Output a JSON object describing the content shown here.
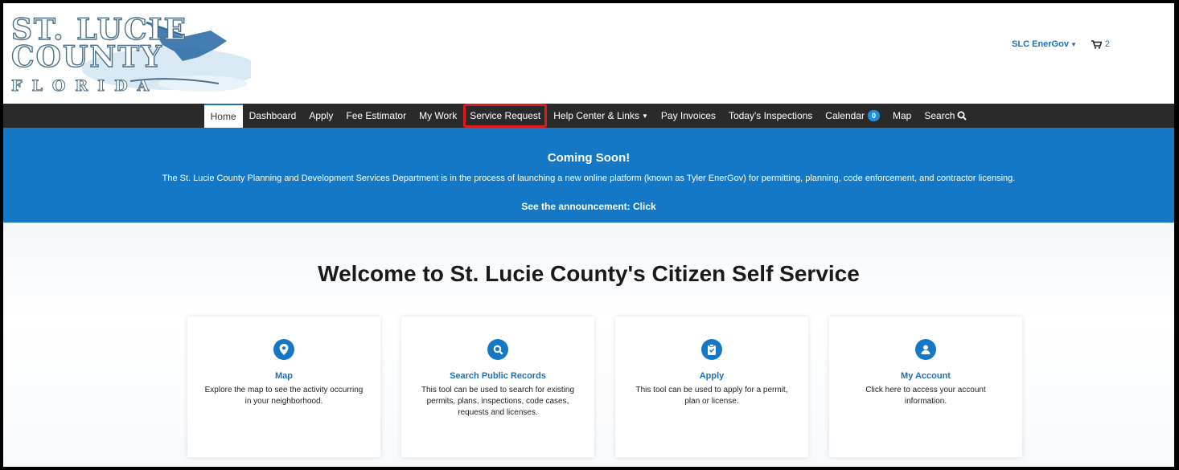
{
  "header": {
    "logo": {
      "line1": "ST. LUCIE",
      "line2": "COUNTY",
      "line3": "FLORIDA"
    },
    "account_menu": "SLC EnerGov",
    "cart_count": "2"
  },
  "nav": {
    "items": [
      {
        "label": "Home"
      },
      {
        "label": "Dashboard"
      },
      {
        "label": "Apply"
      },
      {
        "label": "Fee Estimator"
      },
      {
        "label": "My Work"
      },
      {
        "label": "Service Request"
      },
      {
        "label": "Help Center & Links"
      },
      {
        "label": "Pay Invoices"
      },
      {
        "label": "Today's Inspections"
      },
      {
        "label": "Calendar"
      },
      {
        "label": "Map"
      },
      {
        "label": "Search"
      }
    ],
    "calendar_badge": "0"
  },
  "banner": {
    "title": "Coming Soon!",
    "text": "The St. Lucie County Planning and Development Services Department is in the process of launching a new online platform (known as Tyler EnerGov) for permitting, planning, code enforcement, and contractor licensing.",
    "link": "See the announcement: Click"
  },
  "main": {
    "welcome_title": "Welcome to St. Lucie County's Citizen Self Service",
    "cards": [
      {
        "icon": "map-marker-icon",
        "title": "Map",
        "desc": "Explore the map to see the activity occurring in your neighborhood."
      },
      {
        "icon": "search-icon",
        "title": "Search Public Records",
        "desc": "This tool can be used to search for existing permits, plans, inspections, code cases, requests and licenses."
      },
      {
        "icon": "clipboard-check-icon",
        "title": "Apply",
        "desc": "This tool can be used to apply for a permit, plan or license."
      },
      {
        "icon": "user-icon",
        "title": "My Account",
        "desc": "Click here to access your account information."
      }
    ]
  },
  "colors": {
    "accent": "#1478c6",
    "nav_bg": "#2a2a2a",
    "highlight": "#e01b1b"
  }
}
